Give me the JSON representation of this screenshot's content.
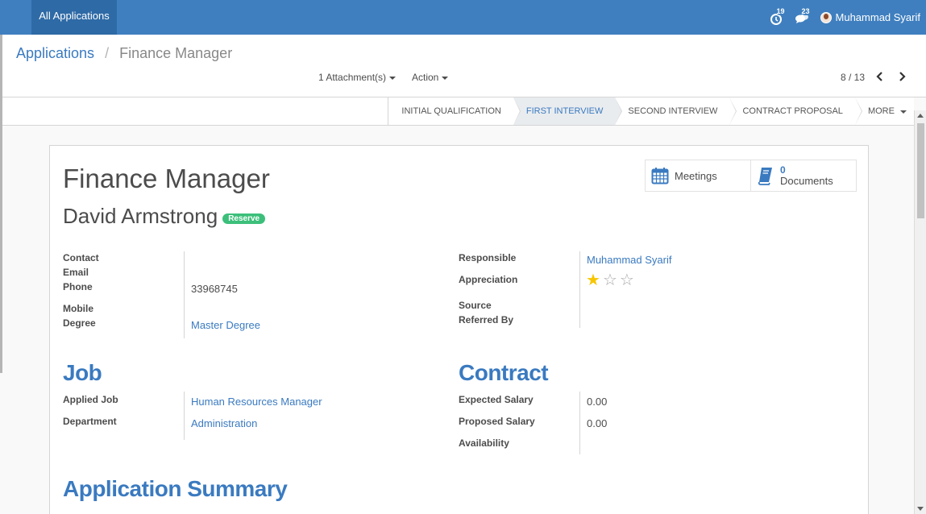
{
  "navbar": {
    "apps_label": "All Applications",
    "activity_count": "19",
    "messages_count": "23",
    "user_name": "Muhammad Syarif"
  },
  "breadcrumb": {
    "parent": "Applications",
    "separator": "/",
    "current": "Finance Manager"
  },
  "toolbar": {
    "attachments_label": "1 Attachment(s)",
    "action_label": "Action"
  },
  "pager": {
    "label": "8 / 13"
  },
  "stages": [
    {
      "label": "INITIAL QUALIFICATION",
      "active": false
    },
    {
      "label": "FIRST INTERVIEW",
      "active": true
    },
    {
      "label": "SECOND INTERVIEW",
      "active": false
    },
    {
      "label": "CONTRACT PROPOSAL",
      "active": false
    },
    {
      "label": "MORE",
      "active": false
    }
  ],
  "record": {
    "title": "Finance Manager",
    "partner_name": "David Armstrong",
    "tag": "Reserve"
  },
  "smart_buttons": {
    "meetings_label": "Meetings",
    "documents_count": "0",
    "documents_label": "Documents"
  },
  "left_fields": {
    "contact_label": "Contact",
    "email_label": "Email",
    "phone_label": "Phone",
    "phone_value": "33968745",
    "mobile_label": "Mobile",
    "degree_label": "Degree",
    "degree_value": "Master Degree"
  },
  "right_fields": {
    "responsible_label": "Responsible",
    "responsible_value": "Muhammad Syarif",
    "appreciation_label": "Appreciation",
    "appreciation_stars": 1,
    "appreciation_max": 3,
    "source_label": "Source",
    "referred_label": "Referred By"
  },
  "job_section": {
    "title": "Job",
    "applied_job_label": "Applied Job",
    "applied_job_value": "Human Resources Manager",
    "department_label": "Department",
    "department_value": "Administration"
  },
  "contract_section": {
    "title": "Contract",
    "expected_label": "Expected Salary",
    "expected_value": "0.00",
    "proposed_label": "Proposed Salary",
    "proposed_value": "0.00",
    "availability_label": "Availability"
  },
  "summary_section": {
    "title": "Application Summary"
  },
  "colors": {
    "navbar": "#3f7fbf",
    "link": "#3a7ac0",
    "badge": "#3cbf7a",
    "star": "#f7c600"
  }
}
